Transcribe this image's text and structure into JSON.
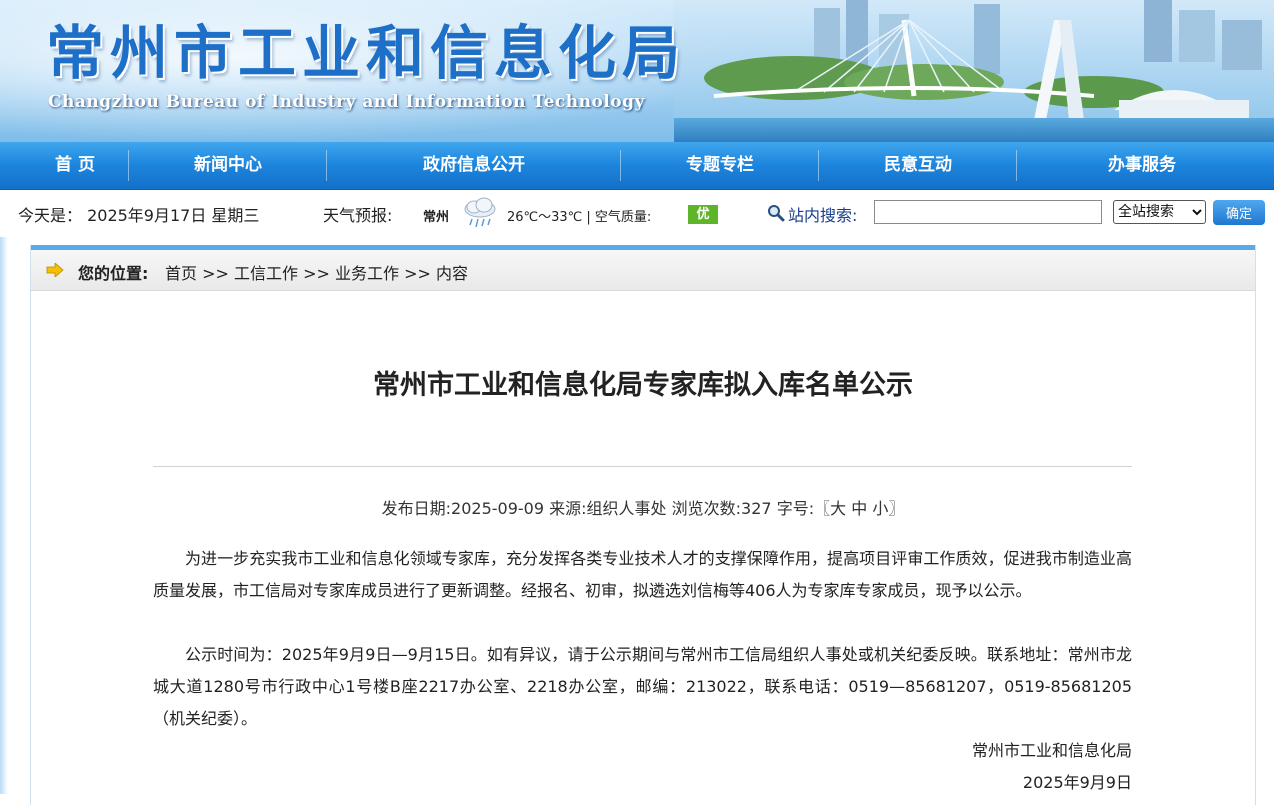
{
  "header": {
    "title": "常州市工业和信息化局",
    "subtitle": "Changzhou Bureau of Industry and Information Technology"
  },
  "nav": {
    "items": [
      {
        "label": "首 页"
      },
      {
        "label": "新闻中心"
      },
      {
        "label": "政府信息公开"
      },
      {
        "label": "专题专栏"
      },
      {
        "label": "民意互动"
      },
      {
        "label": "办事服务"
      }
    ]
  },
  "infobar": {
    "today": "今天是： 2025年9月17日 星期三",
    "weather_label": "天气预报:",
    "city": "常州",
    "temperature": "26℃～33℃ | 空气质量:",
    "air_quality": "优",
    "weather_icon": "rain-cloud-icon",
    "search_label": "站内搜索:",
    "search_value": "",
    "search_scope": "全站搜索",
    "confirm_label": "确定"
  },
  "location": {
    "label": "您的位置:",
    "crumbs": [
      "首页",
      "工信工作",
      "业务工作",
      "内容"
    ],
    "separator": ">>"
  },
  "article": {
    "title": "常州市工业和信息化局专家库拟入库名单公示",
    "meta": {
      "date_label": "发布日期:",
      "date": "2025-09-09",
      "source_label": "来源:",
      "source": "组织人事处",
      "views_label": "浏览次数:",
      "views": "327",
      "font_label": "字号:",
      "font_open": "〖",
      "font_large": "大",
      "font_medium": "中",
      "font_small": "小",
      "font_close": "〗"
    },
    "paragraphs": [
      "为进一步充实我市工业和信息化领域专家库，充分发挥各类专业技术人才的支撑保障作用，提高项目评审工作质效，促进我市制造业高质量发展，市工信局对专家库成员进行了更新调整。经报名、初审，拟遴选刘信梅等406人为专家库专家成员，现予以公示。",
      "公示时间为：2025年9月9日—9月15日。如有异议，请于公示期间与常州市工信局组织人事处或机关纪委反映。联系地址：常州市龙城大道1280号市行政中心1号楼B座2217办公室、2218办公室，邮编：213022，联系电话：0519—85681207，0519-85681205（机关纪委）。"
    ],
    "signature": {
      "org": "常州市工业和信息化局",
      "date": "2025年9月9日"
    }
  },
  "colors": {
    "nav_blue": "#1c84dc",
    "title_blue": "#1d6fc8",
    "aq_green": "#5fb52a",
    "panel_border": "#5ba9e6"
  }
}
